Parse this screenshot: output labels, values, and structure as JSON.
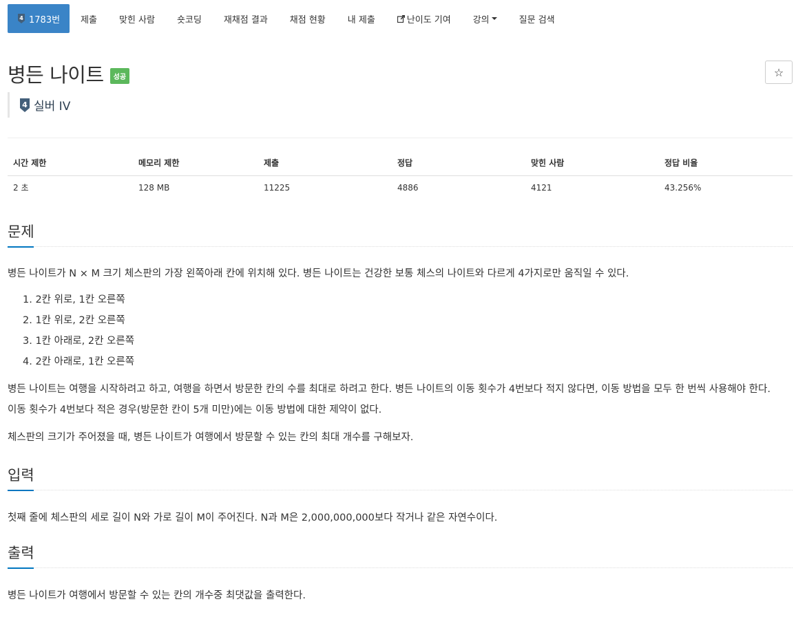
{
  "nav": {
    "problem_tab": "1783번",
    "items": [
      "제출",
      "맞힌 사람",
      "숏코딩",
      "재채점 결과",
      "채점 현황",
      "내 제출",
      "난이도 기여",
      "강의",
      "질문 검색"
    ]
  },
  "problem": {
    "title": "병든 나이트",
    "result_badge": "성공",
    "star_icon": "☆",
    "tier_number": "4",
    "tier_label": "실버 IV"
  },
  "info_table": {
    "headers": [
      "시간 제한",
      "메모리 제한",
      "제출",
      "정답",
      "맞힌 사람",
      "정답 비율"
    ],
    "values": [
      "2 초",
      "128 MB",
      "11225",
      "4886",
      "4121",
      "43.256%"
    ]
  },
  "sections": {
    "description": {
      "heading": "문제",
      "intro": "병든 나이트가 N × M 크기 체스판의 가장 왼쪽아래 칸에 위치해 있다. 병든 나이트는 건강한 보통 체스의 나이트와 다르게 4가지로만 움직일 수 있다.",
      "moves": [
        "1. 2칸 위로, 1칸 오른쪽",
        "2. 1칸 위로, 2칸 오른쪽",
        "3. 1칸 아래로, 2칸 오른쪽",
        "4. 2칸 아래로, 1칸 오른쪽"
      ],
      "para2_line1": "병든 나이트는 여행을 시작하려고 하고, 여행을 하면서 방문한 칸의 수를 최대로 하려고 한다. 병든 나이트의 이동 횟수가 4번보다 적지 않다면, 이동 방법을 모두 한 번씩 사용해야 한다.",
      "para2_line2": "이동 횟수가 4번보다 적은 경우(방문한 칸이 5개 미만)에는 이동 방법에 대한 제약이 없다.",
      "para3": "체스판의 크기가 주어졌을 때, 병든 나이트가 여행에서 방문할 수 있는 칸의 최대 개수를 구해보자."
    },
    "input": {
      "heading": "입력",
      "text": "첫째 줄에 체스판의 세로 길이 N와 가로 길이 M이 주어진다. N과 M은 2,000,000,000보다 작거나 같은 자연수이다."
    },
    "output": {
      "heading": "출력",
      "text": "병든 나이트가 여행에서 방문할 수 있는 칸의 개수중 최댓값을 출력한다."
    }
  },
  "colors": {
    "nav_active": "#3a84c7",
    "badge_success": "#5cb85c",
    "tier_silver": "#435f7a",
    "section_underline": "#0076c0"
  }
}
